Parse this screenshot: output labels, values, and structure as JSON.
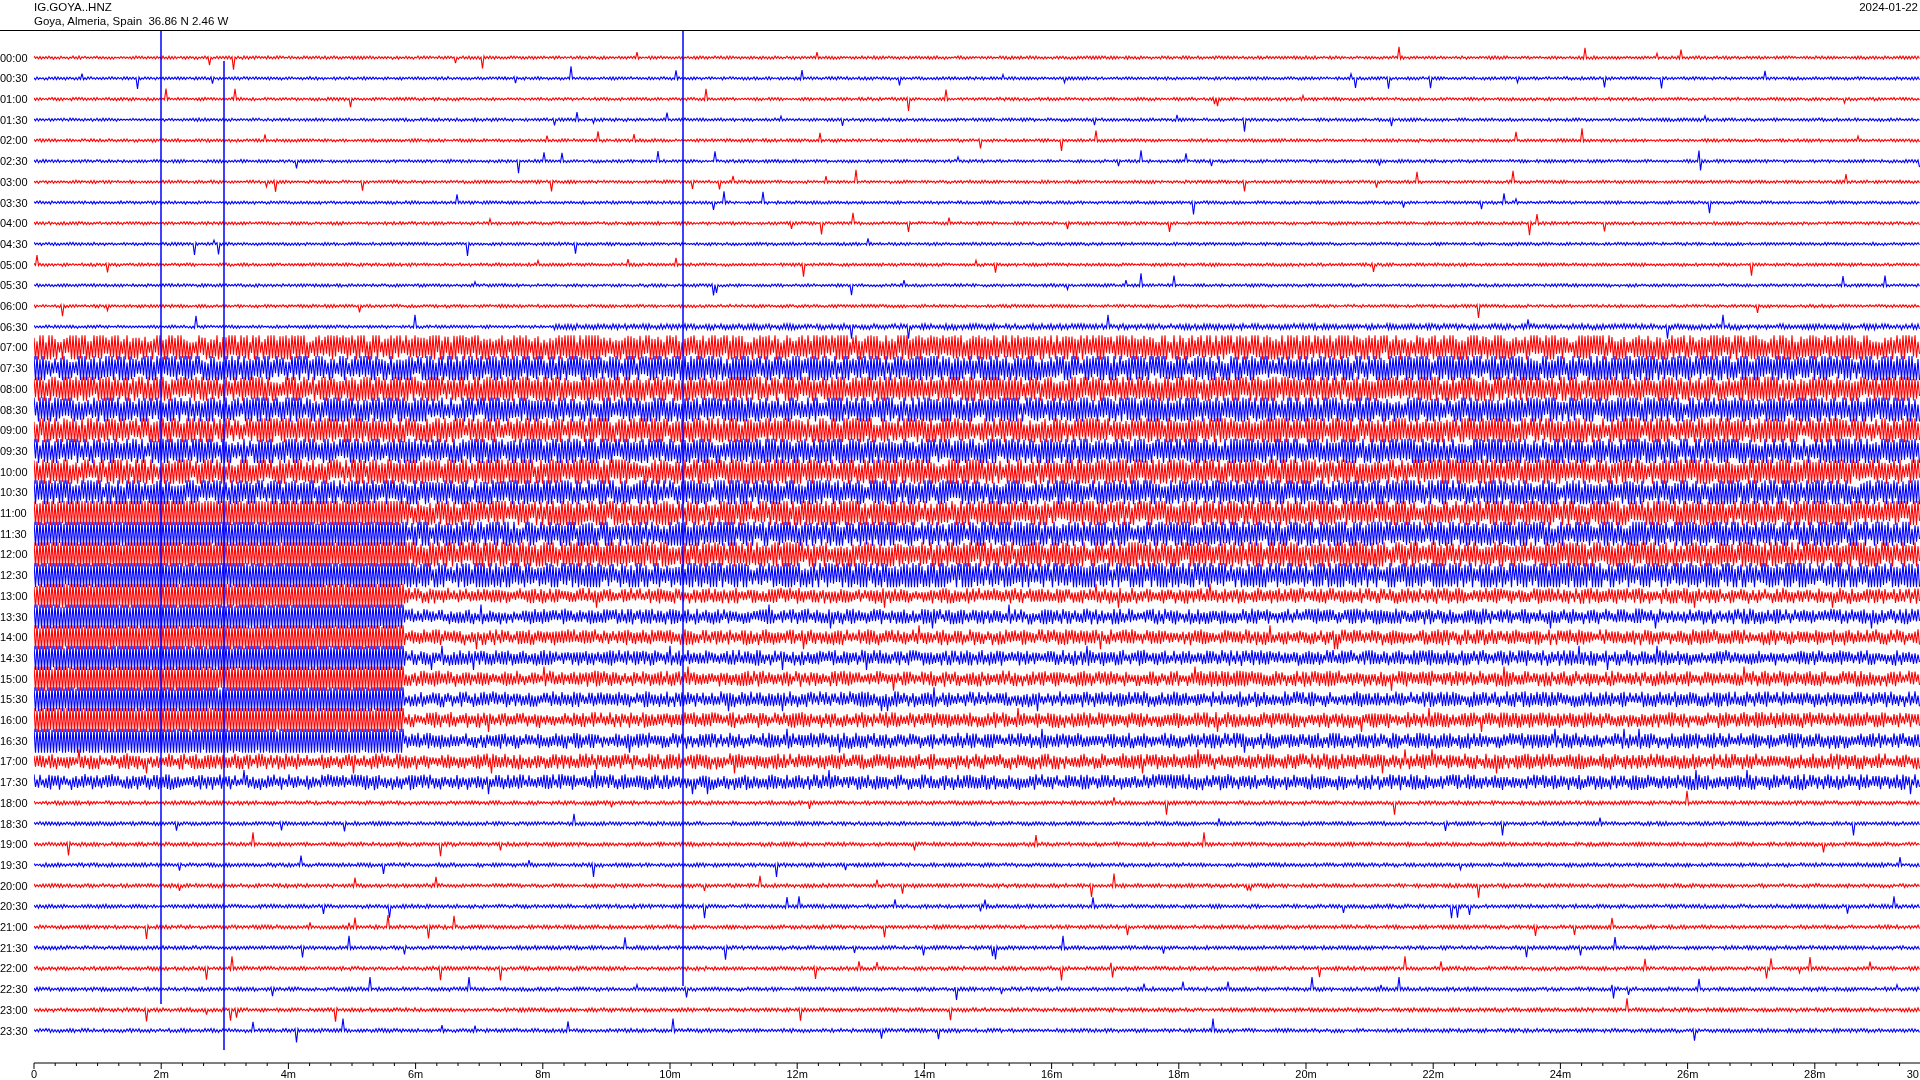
{
  "header": {
    "station": "IG.GOYA..HNZ",
    "location": "Goya, Almeria, Spain  36.86 N 2.46 W",
    "date": "2024-01-22"
  },
  "rows": [
    {
      "time": "00:00",
      "color": "#ff0000"
    },
    {
      "time": "00:30",
      "color": "#0000ff"
    },
    {
      "time": "01:00",
      "color": "#ff0000"
    },
    {
      "time": "01:30",
      "color": "#0000ff"
    },
    {
      "time": "02:00",
      "color": "#ff0000"
    },
    {
      "time": "02:30",
      "color": "#0000ff"
    },
    {
      "time": "03:00",
      "color": "#ff0000"
    },
    {
      "time": "03:30",
      "color": "#0000ff"
    },
    {
      "time": "04:00",
      "color": "#ff0000"
    },
    {
      "time": "04:30",
      "color": "#0000ff"
    },
    {
      "time": "05:00",
      "color": "#ff0000"
    },
    {
      "time": "05:30",
      "color": "#0000ff"
    },
    {
      "time": "06:00",
      "color": "#ff0000"
    },
    {
      "time": "06:30",
      "color": "#0000ff"
    },
    {
      "time": "07:00",
      "color": "#ff0000"
    },
    {
      "time": "07:30",
      "color": "#0000ff"
    },
    {
      "time": "08:00",
      "color": "#ff0000"
    },
    {
      "time": "08:30",
      "color": "#0000ff"
    },
    {
      "time": "09:00",
      "color": "#ff0000"
    },
    {
      "time": "09:30",
      "color": "#0000ff"
    },
    {
      "time": "10:00",
      "color": "#ff0000"
    },
    {
      "time": "10:30",
      "color": "#0000ff"
    },
    {
      "time": "11:00",
      "color": "#ff0000"
    },
    {
      "time": "11:30",
      "color": "#0000ff"
    },
    {
      "time": "12:00",
      "color": "#ff0000"
    },
    {
      "time": "12:30",
      "color": "#0000ff"
    },
    {
      "time": "13:00",
      "color": "#ff0000"
    },
    {
      "time": "13:30",
      "color": "#0000ff"
    },
    {
      "time": "14:00",
      "color": "#ff0000"
    },
    {
      "time": "14:30",
      "color": "#0000ff"
    },
    {
      "time": "15:00",
      "color": "#ff0000"
    },
    {
      "time": "15:30",
      "color": "#0000ff"
    },
    {
      "time": "16:00",
      "color": "#ff0000"
    },
    {
      "time": "16:30",
      "color": "#0000ff"
    },
    {
      "time": "17:00",
      "color": "#ff0000"
    },
    {
      "time": "17:30",
      "color": "#0000ff"
    },
    {
      "time": "18:00",
      "color": "#ff0000"
    },
    {
      "time": "18:30",
      "color": "#0000ff"
    },
    {
      "time": "19:00",
      "color": "#ff0000"
    },
    {
      "time": "19:30",
      "color": "#0000ff"
    },
    {
      "time": "20:00",
      "color": "#ff0000"
    },
    {
      "time": "20:30",
      "color": "#0000ff"
    },
    {
      "time": "21:00",
      "color": "#ff0000"
    },
    {
      "time": "21:30",
      "color": "#0000ff"
    },
    {
      "time": "22:00",
      "color": "#ff0000"
    },
    {
      "time": "22:30",
      "color": "#0000ff"
    },
    {
      "time": "23:00",
      "color": "#ff0000"
    },
    {
      "time": "23:30",
      "color": "#0000ff"
    }
  ],
  "x_axis": {
    "ticks": [
      "0",
      "2m",
      "4m",
      "6m",
      "8m",
      "10m",
      "12m",
      "14m",
      "16m",
      "18m",
      "20m",
      "22m",
      "24m",
      "26m",
      "28m",
      "30"
    ]
  }
}
